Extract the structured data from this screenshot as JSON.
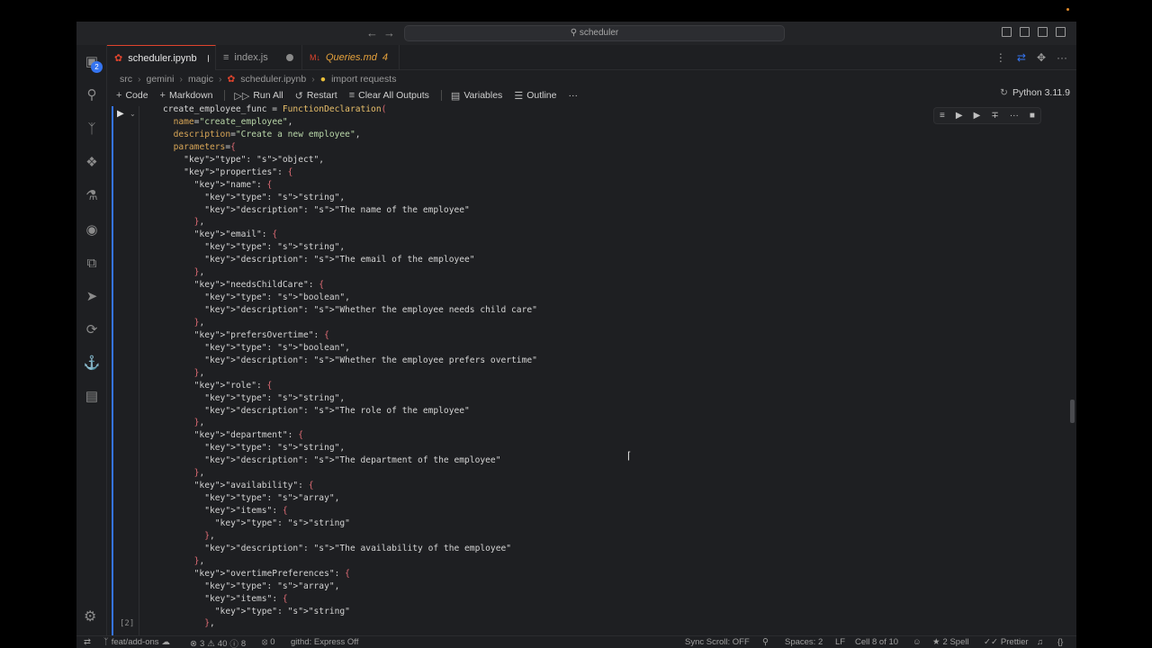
{
  "title_bar": {
    "search_text": "scheduler"
  },
  "activity_badge": "2",
  "tabs": [
    {
      "label": "scheduler.ipynb",
      "icon": "jupyter-icon"
    },
    {
      "label": "index.js",
      "icon": "file-icon"
    },
    {
      "label": "Queries.md",
      "badge": "4",
      "icon": "markdown-icon"
    }
  ],
  "breadcrumb": [
    "src",
    "gemini",
    "magic",
    "scheduler.ipynb",
    "import requests"
  ],
  "toolbar": {
    "code": "Code",
    "markdown": "Markdown",
    "run_all": "Run All",
    "restart": "Restart",
    "clear_outputs": "Clear All Outputs",
    "variables": "Variables",
    "outline": "Outline",
    "more": "···",
    "kernel": "Python 3.11.9"
  },
  "cell": {
    "exec_count": "[2]"
  },
  "code_lines": [
    "create_employee_func = FunctionDeclaration(",
    "  name=\"create_employee\",",
    "  description=\"Create a new employee\",",
    "  parameters={",
    "    \"type\": \"object\",",
    "    \"properties\": {",
    "      \"name\": {",
    "        \"type\": \"string\",",
    "        \"description\": \"The name of the employee\"",
    "      },",
    "      \"email\": {",
    "        \"type\": \"string\",",
    "        \"description\": \"The email of the employee\"",
    "      },",
    "      \"needsChildCare\": {",
    "        \"type\": \"boolean\",",
    "        \"description\": \"Whether the employee needs child care\"",
    "      },",
    "      \"prefersOvertime\": {",
    "        \"type\": \"boolean\",",
    "        \"description\": \"Whether the employee prefers overtime\"",
    "      },",
    "      \"role\": {",
    "        \"type\": \"string\",",
    "        \"description\": \"The role of the employee\"",
    "      },",
    "      \"department\": {",
    "        \"type\": \"string\",",
    "        \"description\": \"The department of the employee\"",
    "      },",
    "      \"availability\": {",
    "        \"type\": \"array\",",
    "        \"items\": {",
    "          \"type\": \"string\"",
    "        },",
    "        \"description\": \"The availability of the employee\"",
    "      },",
    "      \"overtimePreferences\": {",
    "        \"type\": \"array\",",
    "        \"items\": {",
    "          \"type\": \"string\"",
    "        },"
  ],
  "status_bar": {
    "branch": "feat/add-ons",
    "errors": "3",
    "warnings": "40",
    "info": "8",
    "ports": "0",
    "githd": "githd: Express Off",
    "sync_scroll": "Sync Scroll: OFF",
    "spaces": "Spaces: 2",
    "eol": "LF",
    "cell_pos": "Cell 8 of 10",
    "spell": "2 Spell",
    "prettier": "Prettier",
    "braces": "{}"
  },
  "colors": {
    "accent": "#3574f0",
    "tab_active_border": "#e0442d",
    "background": "#1e1f22"
  }
}
